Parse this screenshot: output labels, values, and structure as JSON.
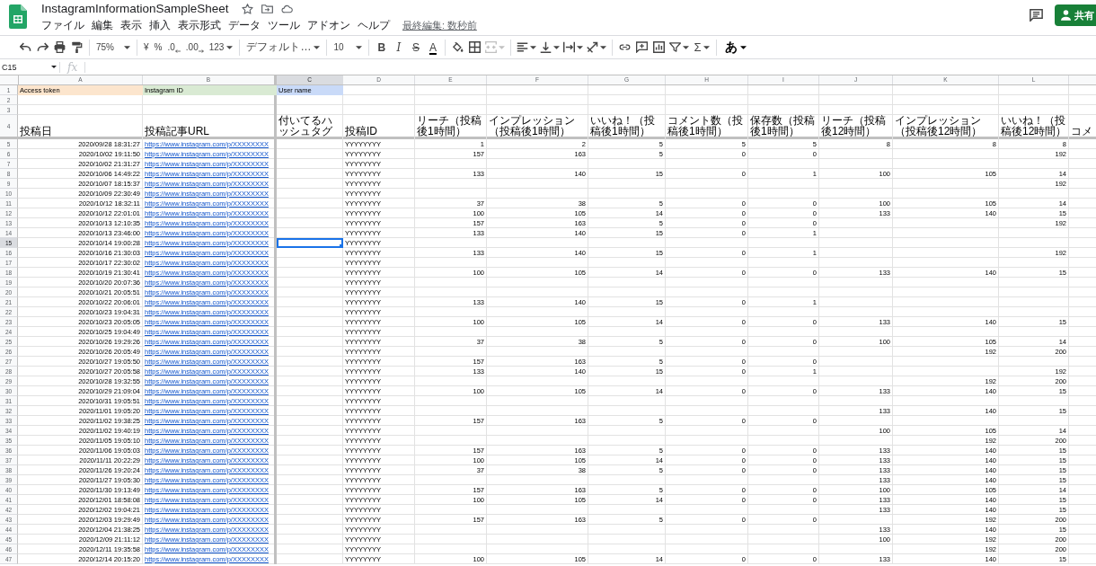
{
  "app": {
    "title": "InstagramInformationSampleSheet",
    "menu": [
      "ファイル",
      "編集",
      "表示",
      "挿入",
      "表示形式",
      "データ",
      "ツール",
      "アドオン",
      "ヘルプ"
    ],
    "last_edit": "最終編集: 数秒前",
    "share": "共有"
  },
  "toolbar": {
    "zoom": "75%",
    "currency": "¥",
    "percent": "%",
    "decrease_decimal": ".0",
    "increase_decimal": ".00",
    "more_formats": "123",
    "font": "デフォルト…",
    "font_size": "10",
    "text_styles": [
      {
        "label": "B",
        "kind": "bold"
      },
      {
        "label": "I",
        "kind": "italic"
      },
      {
        "label": "S",
        "kind": "strike"
      },
      {
        "label": "A",
        "kind": "color"
      }
    ],
    "merge": {
      "disabled": true
    },
    "functions": "Σ",
    "input_tools": "あ"
  },
  "formula_bar": {
    "name_box": "C15",
    "fx": "fx"
  },
  "sheet": {
    "columns": [
      {
        "letter": "A",
        "selected": false
      },
      {
        "letter": "B",
        "selected": false
      },
      {
        "letter": "C",
        "selected": true
      },
      {
        "letter": "D",
        "selected": false
      },
      {
        "letter": "E",
        "selected": false
      },
      {
        "letter": "F",
        "selected": false
      },
      {
        "letter": "G",
        "selected": false
      },
      {
        "letter": "H",
        "selected": false
      },
      {
        "letter": "I",
        "selected": false
      },
      {
        "letter": "J",
        "selected": false
      },
      {
        "letter": "K",
        "selected": false
      },
      {
        "letter": "L",
        "selected": false
      }
    ],
    "rows": [
      {
        "number": "1",
        "selected": false,
        "kind": "params",
        "params": [
          {
            "label": "Access token",
            "color": "#fce5cd"
          },
          {
            "label": "Instagram ID",
            "color": "#d9ead3"
          },
          {
            "label": "User name",
            "color": "#c9daf8"
          }
        ]
      },
      {
        "number": "2",
        "selected": false,
        "kind": "blank"
      },
      {
        "number": "3",
        "selected": false,
        "kind": "blank"
      },
      {
        "number": "4",
        "selected": false,
        "kind": "header",
        "headers": [
          "投稿日",
          "投稿記事URL",
          "付いてるハッシュタグ",
          "投稿ID",
          "リーチ（投稿後1時間）",
          "インプレッション（投稿後1時間）",
          "いいね！（投稿後1時間）",
          "コメント数（投稿後1時間）",
          "保存数（投稿後1時間）",
          "リーチ（投稿後12時間）",
          "インプレッション（投稿後12時間）",
          "いいね！（投稿後12時間）",
          "コメ"
        ]
      },
      {
        "number": "5",
        "selected": false,
        "kind": "record",
        "posted_at": "2020/09/28 18:31:27",
        "url": "https://www.instagram.com/p/XXXXXXXX",
        "post_id": "YYYYYYYY",
        "reach_1h": "1",
        "impressions_1h": "2",
        "likes_1h": "5",
        "comments_1h": "5",
        "saves_1h": "5",
        "reach_12h": "8",
        "impressions_12h": "8",
        "likes_12h": "8"
      },
      {
        "number": "6",
        "selected": false,
        "kind": "record",
        "posted_at": "2020/10/02 19:11:50",
        "url": "https://www.instagram.com/p/XXXXXXXX",
        "post_id": "YYYYYYYY",
        "reach_1h": "157",
        "impressions_1h": "163",
        "likes_1h": "5",
        "comments_1h": "0",
        "saves_1h": "0",
        "likes_12h": "192"
      },
      {
        "number": "7",
        "selected": false,
        "kind": "record",
        "posted_at": "2020/10/02 21:31:27",
        "url": "https://www.instagram.com/p/XXXXXXXX",
        "post_id": "YYYYYYYY"
      },
      {
        "number": "8",
        "selected": false,
        "kind": "record",
        "posted_at": "2020/10/06 14:49:22",
        "url": "https://www.instagram.com/p/XXXXXXXX",
        "post_id": "YYYYYYYY",
        "reach_1h": "133",
        "impressions_1h": "140",
        "likes_1h": "15",
        "comments_1h": "0",
        "saves_1h": "1",
        "reach_12h": "100",
        "impressions_12h": "105",
        "likes_12h": "14"
      },
      {
        "number": "9",
        "selected": false,
        "kind": "record",
        "posted_at": "2020/10/07 18:15:37",
        "url": "https://www.instagram.com/p/XXXXXXXX",
        "post_id": "YYYYYYYY",
        "likes_12h": "192"
      },
      {
        "number": "10",
        "selected": false,
        "kind": "record",
        "posted_at": "2020/10/09 22:30:49",
        "url": "https://www.instagram.com/p/XXXXXXXX",
        "post_id": "YYYYYYYY"
      },
      {
        "number": "11",
        "selected": false,
        "kind": "record",
        "posted_at": "2020/10/12 18:32:11",
        "url": "https://www.instagram.com/p/XXXXXXXX",
        "post_id": "YYYYYYYY",
        "reach_1h": "37",
        "impressions_1h": "38",
        "likes_1h": "5",
        "comments_1h": "0",
        "saves_1h": "0",
        "reach_12h": "100",
        "impressions_12h": "105",
        "likes_12h": "14"
      },
      {
        "number": "12",
        "selected": false,
        "kind": "record",
        "posted_at": "2020/10/12 22:01:01",
        "url": "https://www.instagram.com/p/XXXXXXXX",
        "post_id": "YYYYYYYY",
        "reach_1h": "100",
        "impressions_1h": "105",
        "likes_1h": "14",
        "comments_1h": "0",
        "saves_1h": "0",
        "reach_12h": "133",
        "impressions_12h": "140",
        "likes_12h": "15"
      },
      {
        "number": "13",
        "selected": false,
        "kind": "record",
        "posted_at": "2020/10/13 12:10:35",
        "url": "https://www.instagram.com/p/XXXXXXXX",
        "post_id": "YYYYYYYY",
        "reach_1h": "157",
        "impressions_1h": "163",
        "likes_1h": "5",
        "comments_1h": "0",
        "saves_1h": "0",
        "likes_12h": "192"
      },
      {
        "number": "14",
        "selected": false,
        "kind": "record",
        "posted_at": "2020/10/13 23:46:00",
        "url": "https://www.instagram.com/p/XXXXXXXX",
        "post_id": "YYYYYYYY",
        "reach_1h": "133",
        "impressions_1h": "140",
        "likes_1h": "15",
        "comments_1h": "0",
        "saves_1h": "1"
      },
      {
        "number": "15",
        "selected": true,
        "kind": "record",
        "posted_at": "2020/10/14 19:00:28",
        "url": "https://www.instagram.com/p/XXXXXXXX",
        "post_id": "YYYYYYYY"
      },
      {
        "number": "16",
        "selected": false,
        "kind": "record",
        "posted_at": "2020/10/16 21:30:03",
        "url": "https://www.instagram.com/p/XXXXXXXX",
        "post_id": "YYYYYYYY",
        "reach_1h": "133",
        "impressions_1h": "140",
        "likes_1h": "15",
        "comments_1h": "0",
        "saves_1h": "1",
        "likes_12h": "192"
      },
      {
        "number": "17",
        "selected": false,
        "kind": "record",
        "posted_at": "2020/10/17 22:30:02",
        "url": "https://www.instagram.com/p/XXXXXXXX",
        "post_id": "YYYYYYYY"
      },
      {
        "number": "18",
        "selected": false,
        "kind": "record",
        "posted_at": "2020/10/19 21:30:41",
        "url": "https://www.instagram.com/p/XXXXXXXX",
        "post_id": "YYYYYYYY",
        "reach_1h": "100",
        "impressions_1h": "105",
        "likes_1h": "14",
        "comments_1h": "0",
        "saves_1h": "0",
        "reach_12h": "133",
        "impressions_12h": "140",
        "likes_12h": "15"
      },
      {
        "number": "19",
        "selected": false,
        "kind": "record",
        "posted_at": "2020/10/20 20:07:36",
        "url": "https://www.instagram.com/p/XXXXXXXX",
        "post_id": "YYYYYYYY"
      },
      {
        "number": "20",
        "selected": false,
        "kind": "record",
        "posted_at": "2020/10/21 20:05:51",
        "url": "https://www.instagram.com/p/XXXXXXXX",
        "post_id": "YYYYYYYY"
      },
      {
        "number": "21",
        "selected": false,
        "kind": "record",
        "posted_at": "2020/10/22 20:06:01",
        "url": "https://www.instagram.com/p/XXXXXXXX",
        "post_id": "YYYYYYYY",
        "reach_1h": "133",
        "impressions_1h": "140",
        "likes_1h": "15",
        "comments_1h": "0",
        "saves_1h": "1"
      },
      {
        "number": "22",
        "selected": false,
        "kind": "record",
        "posted_at": "2020/10/23 19:04:31",
        "url": "https://www.instagram.com/p/XXXXXXXX",
        "post_id": "YYYYYYYY"
      },
      {
        "number": "23",
        "selected": false,
        "kind": "record",
        "posted_at": "2020/10/23 20:05:05",
        "url": "https://www.instagram.com/p/XXXXXXXX",
        "post_id": "YYYYYYYY",
        "reach_1h": "100",
        "impressions_1h": "105",
        "likes_1h": "14",
        "comments_1h": "0",
        "saves_1h": "0",
        "reach_12h": "133",
        "impressions_12h": "140",
        "likes_12h": "15"
      },
      {
        "number": "24",
        "selected": false,
        "kind": "record",
        "posted_at": "2020/10/25 19:04:49",
        "url": "https://www.instagram.com/p/XXXXXXXX",
        "post_id": "YYYYYYYY"
      },
      {
        "number": "25",
        "selected": false,
        "kind": "record",
        "posted_at": "2020/10/26 19:29:26",
        "url": "https://www.instagram.com/p/XXXXXXXX",
        "post_id": "YYYYYYYY",
        "reach_1h": "37",
        "impressions_1h": "38",
        "likes_1h": "5",
        "comments_1h": "0",
        "saves_1h": "0",
        "reach_12h": "100",
        "impressions_12h": "105",
        "likes_12h": "14"
      },
      {
        "number": "26",
        "selected": false,
        "kind": "record",
        "posted_at": "2020/10/26 20:05:49",
        "url": "https://www.instagram.com/p/XXXXXXXX",
        "post_id": "YYYYYYYY",
        "impressions_12h": "192",
        "likes_12h": "200"
      },
      {
        "number": "27",
        "selected": false,
        "kind": "record",
        "posted_at": "2020/10/27 19:05:50",
        "url": "https://www.instagram.com/p/XXXXXXXX",
        "post_id": "YYYYYYYY",
        "reach_1h": "157",
        "impressions_1h": "163",
        "likes_1h": "5",
        "comments_1h": "0",
        "saves_1h": "0"
      },
      {
        "number": "28",
        "selected": false,
        "kind": "record",
        "posted_at": "2020/10/27 20:05:58",
        "url": "https://www.instagram.com/p/XXXXXXXX",
        "post_id": "YYYYYYYY",
        "reach_1h": "133",
        "impressions_1h": "140",
        "likes_1h": "15",
        "comments_1h": "0",
        "saves_1h": "1",
        "likes_12h": "192"
      },
      {
        "number": "29",
        "selected": false,
        "kind": "record",
        "posted_at": "2020/10/28 19:32:55",
        "url": "https://www.instagram.com/p/XXXXXXXX",
        "post_id": "YYYYYYYY",
        "impressions_12h": "192",
        "likes_12h": "200"
      },
      {
        "number": "30",
        "selected": false,
        "kind": "record",
        "posted_at": "2020/10/29 21:09:04",
        "url": "https://www.instagram.com/p/XXXXXXXX",
        "post_id": "YYYYYYYY",
        "reach_1h": "100",
        "impressions_1h": "105",
        "likes_1h": "14",
        "comments_1h": "0",
        "saves_1h": "0",
        "reach_12h": "133",
        "impressions_12h": "140",
        "likes_12h": "15"
      },
      {
        "number": "31",
        "selected": false,
        "kind": "record",
        "posted_at": "2020/10/31 19:05:51",
        "url": "https://www.instagram.com/p/XXXXXXXX",
        "post_id": "YYYYYYYY"
      },
      {
        "number": "32",
        "selected": false,
        "kind": "record",
        "posted_at": "2020/11/01 19:05:20",
        "url": "https://www.instagram.com/p/XXXXXXXX",
        "post_id": "YYYYYYYY",
        "reach_12h": "133",
        "impressions_12h": "140",
        "likes_12h": "15"
      },
      {
        "number": "33",
        "selected": false,
        "kind": "record",
        "posted_at": "2020/11/02 19:38:25",
        "url": "https://www.instagram.com/p/XXXXXXXX",
        "post_id": "YYYYYYYY",
        "reach_1h": "157",
        "impressions_1h": "163",
        "likes_1h": "5",
        "comments_1h": "0",
        "saves_1h": "0"
      },
      {
        "number": "34",
        "selected": false,
        "kind": "record",
        "posted_at": "2020/11/02 19:40:19",
        "url": "https://www.instagram.com/p/XXXXXXXX",
        "post_id": "YYYYYYYY",
        "reach_12h": "100",
        "impressions_12h": "105",
        "likes_12h": "14"
      },
      {
        "number": "35",
        "selected": false,
        "kind": "record",
        "posted_at": "2020/11/05 19:05:10",
        "url": "https://www.instagram.com/p/XXXXXXXX",
        "post_id": "YYYYYYYY",
        "impressions_12h": "192",
        "likes_12h": "200"
      },
      {
        "number": "36",
        "selected": false,
        "kind": "record",
        "posted_at": "2020/11/06 19:05:03",
        "url": "https://www.instagram.com/p/XXXXXXXX",
        "post_id": "YYYYYYYY",
        "reach_1h": "157",
        "impressions_1h": "163",
        "likes_1h": "5",
        "comments_1h": "0",
        "saves_1h": "0",
        "reach_12h": "133",
        "impressions_12h": "140",
        "likes_12h": "15"
      },
      {
        "number": "37",
        "selected": false,
        "kind": "record",
        "posted_at": "2020/11/11 20:22:29",
        "url": "https://www.instagram.com/p/XXXXXXXX",
        "post_id": "YYYYYYYY",
        "reach_1h": "100",
        "impressions_1h": "105",
        "likes_1h": "14",
        "comments_1h": "0",
        "saves_1h": "0",
        "reach_12h": "133",
        "impressions_12h": "140",
        "likes_12h": "15"
      },
      {
        "number": "38",
        "selected": false,
        "kind": "record",
        "posted_at": "2020/11/26 19:20:24",
        "url": "https://www.instagram.com/p/XXXXXXXX",
        "post_id": "YYYYYYYY",
        "reach_1h": "37",
        "impressions_1h": "38",
        "likes_1h": "5",
        "comments_1h": "0",
        "saves_1h": "0",
        "reach_12h": "133",
        "impressions_12h": "140",
        "likes_12h": "15"
      },
      {
        "number": "39",
        "selected": false,
        "kind": "record",
        "posted_at": "2020/11/27 19:05:30",
        "url": "https://www.instagram.com/p/XXXXXXXX",
        "post_id": "YYYYYYYY",
        "reach_12h": "133",
        "impressions_12h": "140",
        "likes_12h": "15"
      },
      {
        "number": "40",
        "selected": false,
        "kind": "record",
        "posted_at": "2020/11/30 19:13:49",
        "url": "https://www.instagram.com/p/XXXXXXXX",
        "post_id": "YYYYYYYY",
        "reach_1h": "157",
        "impressions_1h": "163",
        "likes_1h": "5",
        "comments_1h": "0",
        "saves_1h": "0",
        "reach_12h": "100",
        "impressions_12h": "105",
        "likes_12h": "14"
      },
      {
        "number": "41",
        "selected": false,
        "kind": "record",
        "posted_at": "2020/12/01 18:58:08",
        "url": "https://www.instagram.com/p/XXXXXXXX",
        "post_id": "YYYYYYYY",
        "reach_1h": "100",
        "impressions_1h": "105",
        "likes_1h": "14",
        "comments_1h": "0",
        "saves_1h": "0",
        "reach_12h": "133",
        "impressions_12h": "140",
        "likes_12h": "15"
      },
      {
        "number": "42",
        "selected": false,
        "kind": "record",
        "posted_at": "2020/12/02 19:04:21",
        "url": "https://www.instagram.com/p/XXXXXXXX",
        "post_id": "YYYYYYYY",
        "reach_12h": "133",
        "impressions_12h": "140",
        "likes_12h": "15"
      },
      {
        "number": "43",
        "selected": false,
        "kind": "record",
        "posted_at": "2020/12/03 19:29:49",
        "url": "https://www.instagram.com/p/XXXXXXXX",
        "post_id": "YYYYYYYY",
        "reach_1h": "157",
        "impressions_1h": "163",
        "likes_1h": "5",
        "comments_1h": "0",
        "saves_1h": "0",
        "impressions_12h": "192",
        "likes_12h": "200"
      },
      {
        "number": "44",
        "selected": false,
        "kind": "record",
        "posted_at": "2020/12/04 21:38:25",
        "url": "https://www.instagram.com/p/XXXXXXXX",
        "post_id": "YYYYYYYY",
        "reach_12h": "133",
        "impressions_12h": "140",
        "likes_12h": "15"
      },
      {
        "number": "45",
        "selected": false,
        "kind": "record",
        "posted_at": "2020/12/09 21:11:12",
        "url": "https://www.instagram.com/p/XXXXXXXX",
        "post_id": "YYYYYYYY",
        "reach_12h": "100",
        "impressions_12h": "192",
        "likes_12h": "200"
      },
      {
        "number": "46",
        "selected": false,
        "kind": "record",
        "posted_at": "2020/12/11 19:35:58",
        "url": "https://www.instagram.com/p/XXXXXXXX",
        "post_id": "YYYYYYYY",
        "impressions_12h": "192",
        "likes_12h": "200"
      },
      {
        "number": "47",
        "selected": false,
        "kind": "record",
        "posted_at": "2020/12/14 20:15:20",
        "url": "https://www.instagram.com/p/XXXXXXXX",
        "post_id": "YYYYYYYY",
        "reach_1h": "100",
        "impressions_1h": "105",
        "likes_1h": "14",
        "comments_1h": "0",
        "saves_1h": "0",
        "reach_12h": "133",
        "impressions_12h": "140",
        "likes_12h": "15"
      }
    ]
  }
}
